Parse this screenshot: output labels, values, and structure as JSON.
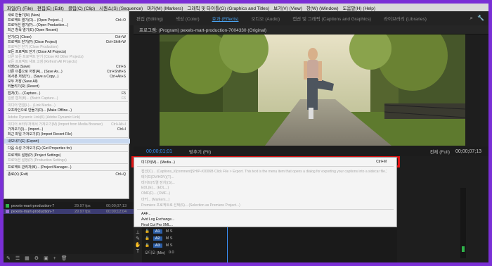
{
  "menubar": [
    "파일(F) (File)",
    "편집(E) (Edit)",
    "클립(C) (Clip)",
    "시퀀스(S) (Sequence)",
    "마커(M) (Markers)",
    "그래픽 및 타이틀(G) (Graphics and Titles)",
    "보기(V) (View)",
    "창(W) (Window)",
    "도움말(H) (Help)"
  ],
  "workspace_tabs": [
    {
      "label": "편집 (Editing)",
      "active": false
    },
    {
      "label": "색상 (Color)",
      "active": false
    },
    {
      "label": "효과 (Effects)",
      "active": true
    },
    {
      "label": "오디오 (Audio)",
      "active": false
    },
    {
      "label": "캡션 및 그래픽 (Captions and Graphics)",
      "active": false
    },
    {
      "label": "라이브러리 (Libraries)",
      "active": false
    }
  ],
  "monitor": {
    "title": "프로그램: (Program) pexels-mart-production-7004330 (Original)",
    "timecode": "00;00;01;01",
    "fit_label": "맞추기 (Fit)",
    "full_label": "전체 (Full)",
    "end_timecode": "00;00;07;13"
  },
  "file_menu": [
    {
      "label": "새로 만들기(N) (New)",
      "sc": "",
      "dis": false
    },
    {
      "label": "프로젝트 열기(O)... (Open Project...)",
      "sc": "Ctrl+O",
      "dis": false
    },
    {
      "label": "프로덕션 열기(P)... (Open Production...)",
      "sc": "",
      "dis": false
    },
    {
      "label": "최근 항목 열기(E) (Open Recent)",
      "sc": "",
      "dis": false
    },
    {
      "sep": true
    },
    {
      "label": "닫기(C) (Close)",
      "sc": "Ctrl+W",
      "dis": false
    },
    {
      "label": "프로젝트 닫기(P) (Close Project)",
      "sc": "Ctrl+Shift+W",
      "dis": false
    },
    {
      "label": "프로덕션 닫기 (Close Production)",
      "sc": "",
      "dis": true
    },
    {
      "label": "모든 프로젝트 닫기 (Close All Projects)",
      "sc": "",
      "dis": false
    },
    {
      "label": "다른 모든 프로젝트 닫기 (Close All Other Projects)",
      "sc": "",
      "dis": true
    },
    {
      "label": "모든 프로젝트 새로 고침 (Refresh All Projects)",
      "sc": "",
      "dis": true
    },
    {
      "label": "저장(S) (Save)",
      "sc": "Ctrl+S",
      "dis": false
    },
    {
      "label": "다른 이름으로 저장(A)... (Save As...)",
      "sc": "Ctrl+Shift+S",
      "dis": false
    },
    {
      "label": "복사본 저장(Y)... (Save a Copy...)",
      "sc": "Ctrl+Alt+S",
      "dis": false
    },
    {
      "label": "모두 저장 (Save All)",
      "sc": "",
      "dis": false
    },
    {
      "label": "되돌리기(R) (Revert)",
      "sc": "",
      "dis": false
    },
    {
      "sep": true
    },
    {
      "label": "캡처(T)... (Capture...)",
      "sc": "F5",
      "dis": false
    },
    {
      "label": "일괄 캡처(B)... (Batch Capture...)",
      "sc": "F6",
      "dis": true
    },
    {
      "sep": true
    },
    {
      "label": "미디어 연결(L)... (Link Media...)",
      "sc": "",
      "dis": true
    },
    {
      "label": "오프라인으로 만들기(O)... (Make Offline...)",
      "sc": "",
      "dis": false
    },
    {
      "sep": true
    },
    {
      "label": "Adobe Dynamic Link(K) (Adobe Dynamic Link)",
      "sc": "",
      "dis": true
    },
    {
      "sep": true
    },
    {
      "label": "미디어 브라우저에서 가져오기(M) (Import from Media Browser)",
      "sc": "Ctrl+Alt+I",
      "dis": true
    },
    {
      "label": "가져오기(I)... (Import...)",
      "sc": "Ctrl+I",
      "dis": false
    },
    {
      "label": "최근 파일 가져오기(F) (Import Recent File)",
      "sc": "",
      "dis": false
    },
    {
      "sep": true
    },
    {
      "label": "내보내기(E) (Export)",
      "sc": "",
      "dis": false,
      "hl": true
    },
    {
      "sep": true
    },
    {
      "label": "다음 속성 가져오기(G) (Get Properties for)",
      "sc": "",
      "dis": false
    },
    {
      "sep": true
    },
    {
      "label": "프로젝트 설정(P) (Project Settings)",
      "sc": "",
      "dis": false
    },
    {
      "label": "프로덕션 설정(P) (Production Settings)",
      "sc": "",
      "dis": true
    },
    {
      "sep": true
    },
    {
      "label": "프로젝트 관리자(M)... (Project Manager...)",
      "sc": "",
      "dis": false
    },
    {
      "sep": true
    },
    {
      "label": "종료(X) (Exit)",
      "sc": "Ctrl+Q",
      "dis": false
    }
  ],
  "export_menu": [
    {
      "label": "미디어(M)... (Media...)",
      "sc": "Ctrl+M",
      "dis": false
    },
    {
      "sep": true
    },
    {
      "label": "캡션(C)... (Captions_#[comment]SHIP-#2006B Click File > Export. This text is the menu item that opens a dialog for exporting your captions into a sidecar file.)",
      "sc": "",
      "dis": true
    },
    {
      "label": "테이프(DV/HDV)(T)...",
      "sc": "",
      "dis": true
    },
    {
      "label": "테이프(직렬 장치)(S)...",
      "sc": "",
      "dis": true
    },
    {
      "label": "EDL(E)... (EDL...)",
      "sc": "",
      "dis": true
    },
    {
      "label": "OMF(F)... (OMF...)",
      "sc": "",
      "dis": true
    },
    {
      "label": "마커... (Markers...)",
      "sc": "",
      "dis": true
    },
    {
      "label": "Premiere 프로젝트로 선택(S)... (Selection as Premiere Project...)",
      "sc": "",
      "dis": true
    },
    {
      "sep": true
    },
    {
      "label": "AAF...",
      "sc": "",
      "dis": false
    },
    {
      "label": "Avid Log Exchange...",
      "sc": "",
      "dis": false
    },
    {
      "label": "Final Cut Pro XML...",
      "sc": "",
      "dis": false
    }
  ],
  "project_rows": [
    {
      "name": "pexels-mart-production-7",
      "frames": "29.97 fps",
      "dur": "00;00;07;13",
      "color": "#2fb34a",
      "selected": false
    },
    {
      "name": "pexels-mart-production-7",
      "frames": "29.97 fps",
      "dur": "00;00;12;04",
      "color": "#9b6fd8",
      "selected": true
    }
  ],
  "tracks": [
    {
      "name": "A1",
      "ctl": "M S"
    },
    {
      "name": "A2",
      "ctl": "M S"
    },
    {
      "name": "A3",
      "ctl": "M S"
    },
    {
      "name": "오디오 (Mix)",
      "ctl": "0.0"
    }
  ],
  "icons": {
    "pen": "✎",
    "settings": "⚙",
    "grid": "▦",
    "list": "☰",
    "search": "⌕",
    "trash": "🗑",
    "folder": "▣",
    "plus": "+",
    "wrench": "🔧"
  }
}
